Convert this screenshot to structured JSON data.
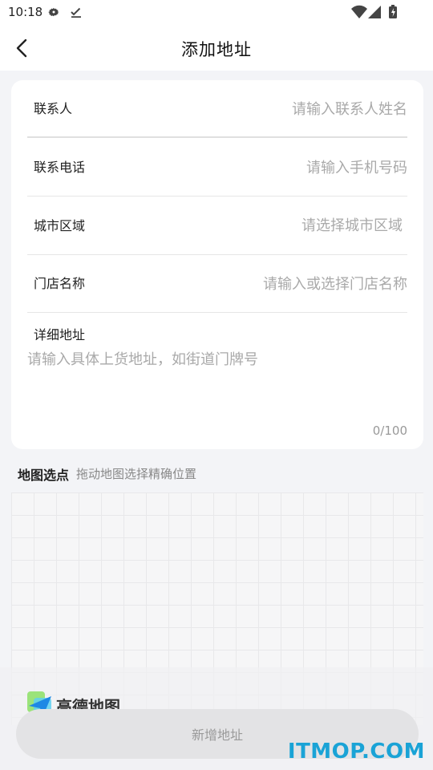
{
  "status_bar": {
    "time": "10:18"
  },
  "nav": {
    "title": "添加地址"
  },
  "form": {
    "rows": [
      {
        "label": "联系人",
        "placeholder": "请输入联系人姓名",
        "value": ""
      },
      {
        "label": "联系电话",
        "placeholder": "请输入手机号码",
        "value": ""
      },
      {
        "label": "城市区域",
        "placeholder": "请选择城市区域"
      },
      {
        "label": "门店名称",
        "placeholder": "请输入或选择门店名称",
        "value": ""
      }
    ],
    "detail": {
      "label": "详细地址",
      "placeholder": "请输入具体上货地址，如街道门牌号",
      "value": "",
      "char_count": "0/100"
    }
  },
  "map": {
    "title": "地图选点",
    "subtitle": "拖动地图选择精确位置",
    "provider_logo_text": "高德地图"
  },
  "footer": {
    "add_button_label": "新增地址"
  },
  "watermark": "ITMOP.COM",
  "colors": {
    "background": "#f3f4f7",
    "card": "#ffffff",
    "placeholder": "#a9a9a9",
    "watermark": "#1aa3d6"
  }
}
